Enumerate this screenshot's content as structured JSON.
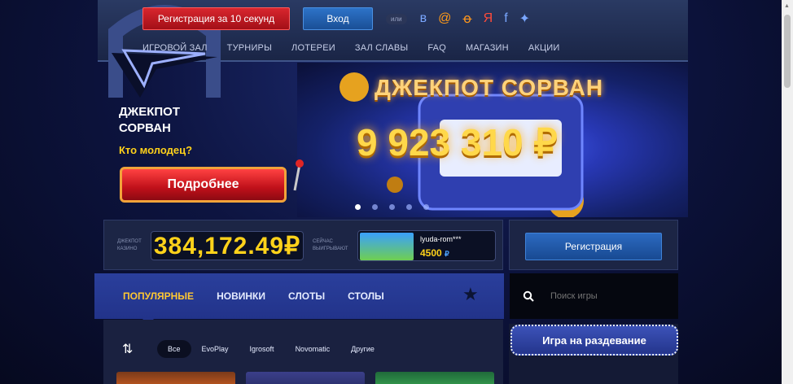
{
  "header": {
    "register_label": "Регистрация за 10 секунд",
    "login_label": "Вход",
    "or_label": "или",
    "social": [
      "вк",
      "@",
      "ок",
      "я",
      "f",
      "tw"
    ]
  },
  "nav": [
    "Игровой зал",
    "Турниры",
    "Лотереи",
    "Зал славы",
    "FAQ",
    "Магазин",
    "Акции"
  ],
  "hero": {
    "headline_line1": "ДЖЕКПОТ",
    "headline_line2": "СОРВАН",
    "subline": "Кто молодец?",
    "details_label": "Подробнее",
    "banner_title": "ДЖЕКПОТ СОРВАН",
    "banner_amount": "9 923 310 ₽",
    "slides_total": 5,
    "slide_active": 1
  },
  "jackpot": {
    "label": "ДЖЕКПОТ КАЗИНО",
    "amount": "384,172.49₽"
  },
  "winner": {
    "label": "СЕЙЧАС ВЫИГРЫВАЮТ",
    "name": "lyuda-rom***",
    "amount": "4500",
    "currency": "₽"
  },
  "side_register_label": "Регистрация",
  "tabs": [
    {
      "label": "Популярные",
      "active": true
    },
    {
      "label": "Новинки",
      "active": false
    },
    {
      "label": "Слоты",
      "active": false
    },
    {
      "label": "Столы",
      "active": false
    }
  ],
  "search": {
    "placeholder": "Поиск игры"
  },
  "filters": [
    {
      "label": "Все",
      "active": true
    },
    {
      "label": "EvoPlay",
      "active": false
    },
    {
      "label": "Igrosoft",
      "active": false
    },
    {
      "label": "Novomatic",
      "active": false
    },
    {
      "label": "Другие",
      "active": false
    }
  ],
  "promo_title": "Игра на раздевание",
  "colors": {
    "accent_yellow": "#ffd21a",
    "register_red": "#c0101a",
    "login_blue": "#1a4f96"
  }
}
